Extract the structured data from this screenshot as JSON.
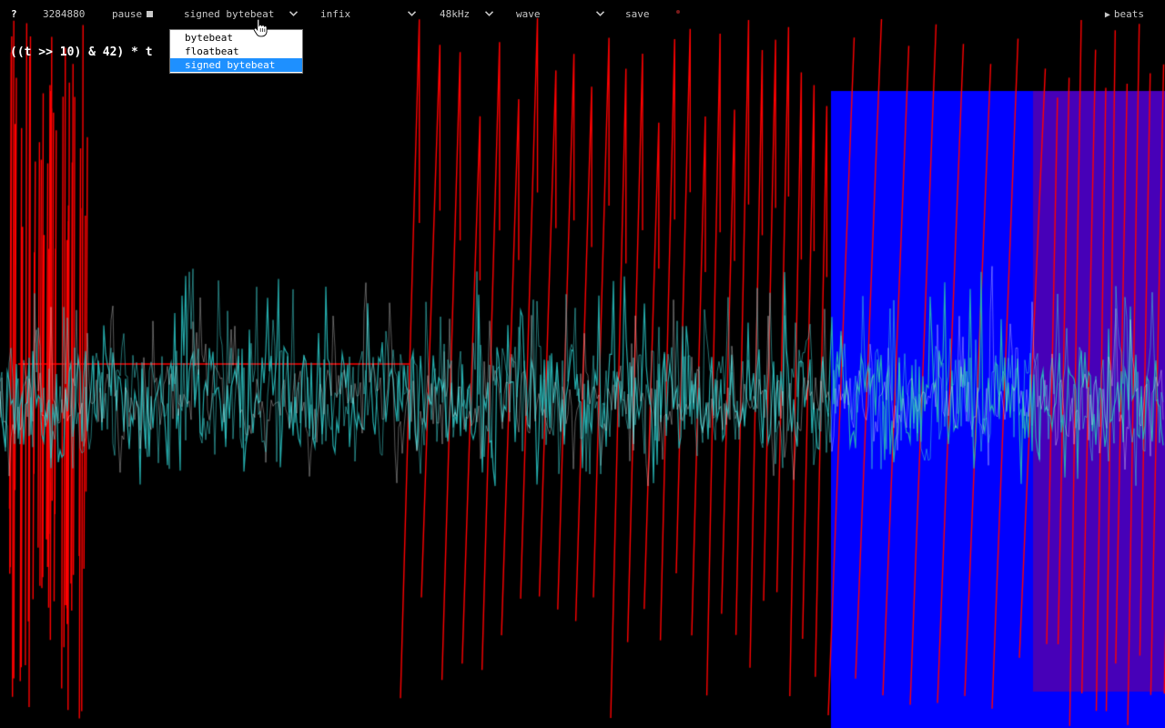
{
  "toolbar": {
    "help_label": "?",
    "time_value": "3284880",
    "pause_label": "pause",
    "mode_value": "signed bytebeat",
    "syntax_value": "infix",
    "rate_value": "48kHz",
    "view_value": "wave",
    "save_label": "save",
    "beats_label": "beats",
    "beats_icon": "play-icon",
    "pause_icon": "stop-square-icon"
  },
  "mode_dropdown": {
    "options": [
      "bytebeat",
      "floatbeat",
      "signed bytebeat"
    ],
    "selected": "signed bytebeat"
  },
  "editor": {
    "code": "((t >> 10) & 42) * t"
  },
  "visualizer": {
    "highlight_color": "#0000ff",
    "sawtooth_color": "#ff0000",
    "wave_color": "#26b3b3",
    "background_color": "#000000"
  },
  "colors": {
    "selected_option_bg": "#1e90ff",
    "toolbar_text": "#c8c8c8"
  }
}
